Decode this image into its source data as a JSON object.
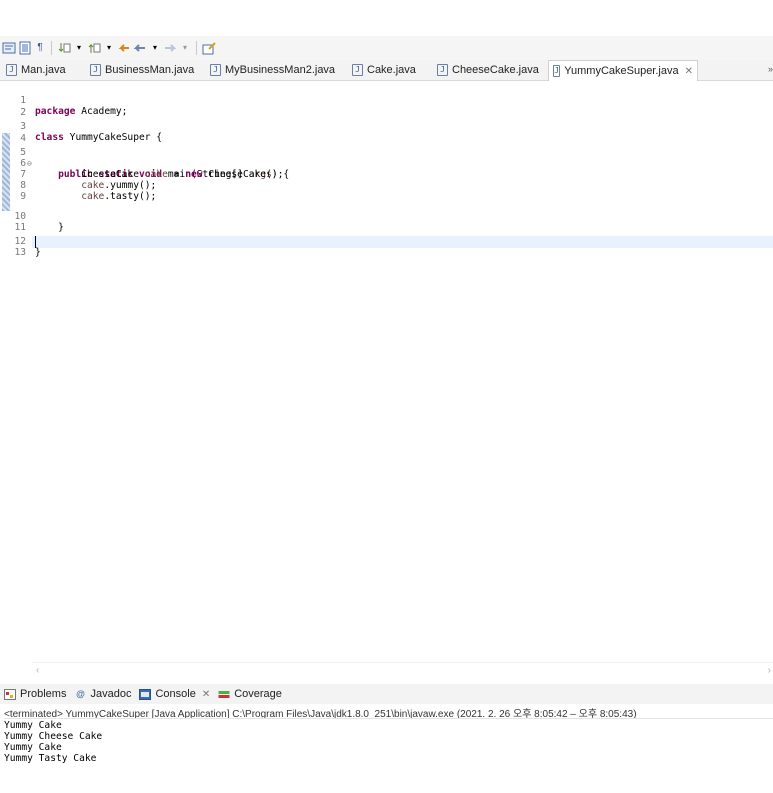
{
  "toolbar": {
    "icons": [
      "toggle-mark-occurrences-icon",
      "toggle-block-selection-icon",
      "show-whitespace-icon",
      "next-annotation-icon",
      "previous-annotation-icon",
      "last-edit-location-icon",
      "back-icon",
      "forward-icon",
      "new-task-icon"
    ]
  },
  "editor_tabs": [
    {
      "label": "Man.java",
      "active": false
    },
    {
      "label": "BusinessMan.java",
      "active": false
    },
    {
      "label": "MyBusinessMan2.java",
      "active": false
    },
    {
      "label": "Cake.java",
      "active": false
    },
    {
      "label": "CheeseCake.java",
      "active": false
    },
    {
      "label": "YummyCakeSuper.java",
      "active": true
    }
  ],
  "editor": {
    "lines": [
      {
        "n": "1",
        "code": "package Academy;"
      },
      {
        "n": "2",
        "code": ""
      },
      {
        "n": "3",
        "code": "class YummyCakeSuper {"
      },
      {
        "n": "4",
        "code": ""
      },
      {
        "n": "5",
        "code": "    public static void main(String[] args) {"
      },
      {
        "n": "6",
        "code": "        CheeseCake cake = new CheeseCake();"
      },
      {
        "n": "7",
        "code": "        cake.yummy();"
      },
      {
        "n": "8",
        "code": "        cake.tasty();"
      },
      {
        "n": "9",
        "code": ""
      },
      {
        "n": "10",
        "code": "    }"
      },
      {
        "n": "11",
        "code": ""
      },
      {
        "n": "12",
        "code": "}"
      },
      {
        "n": "13",
        "code": ""
      }
    ],
    "current_line": 13
  },
  "bottom_panel": {
    "tabs": [
      {
        "label": "Problems",
        "icon": "problems-icon",
        "active": false
      },
      {
        "label": "Javadoc",
        "icon": "javadoc-icon",
        "active": false
      },
      {
        "label": "Console",
        "icon": "console-icon",
        "active": true
      },
      {
        "label": "Coverage",
        "icon": "coverage-icon",
        "active": false
      }
    ],
    "console_description": "<terminated> YummyCakeSuper [Java Application] C:\\Program Files\\Java\\jdk1.8.0_251\\bin\\javaw.exe  (2021. 2. 26 오후 8:05:42 – 오후 8:05:43)",
    "output_lines": [
      "Yummy Cake",
      "Yummy Cheese Cake",
      "Yummy Cake",
      "Yummy Tasty Cake"
    ]
  },
  "colors": {
    "keyword": "#7f0055",
    "local_variable": "#6a3e3e",
    "current_line_highlight": "#e8f2fe",
    "tab_bar": "#f3f3f3"
  }
}
